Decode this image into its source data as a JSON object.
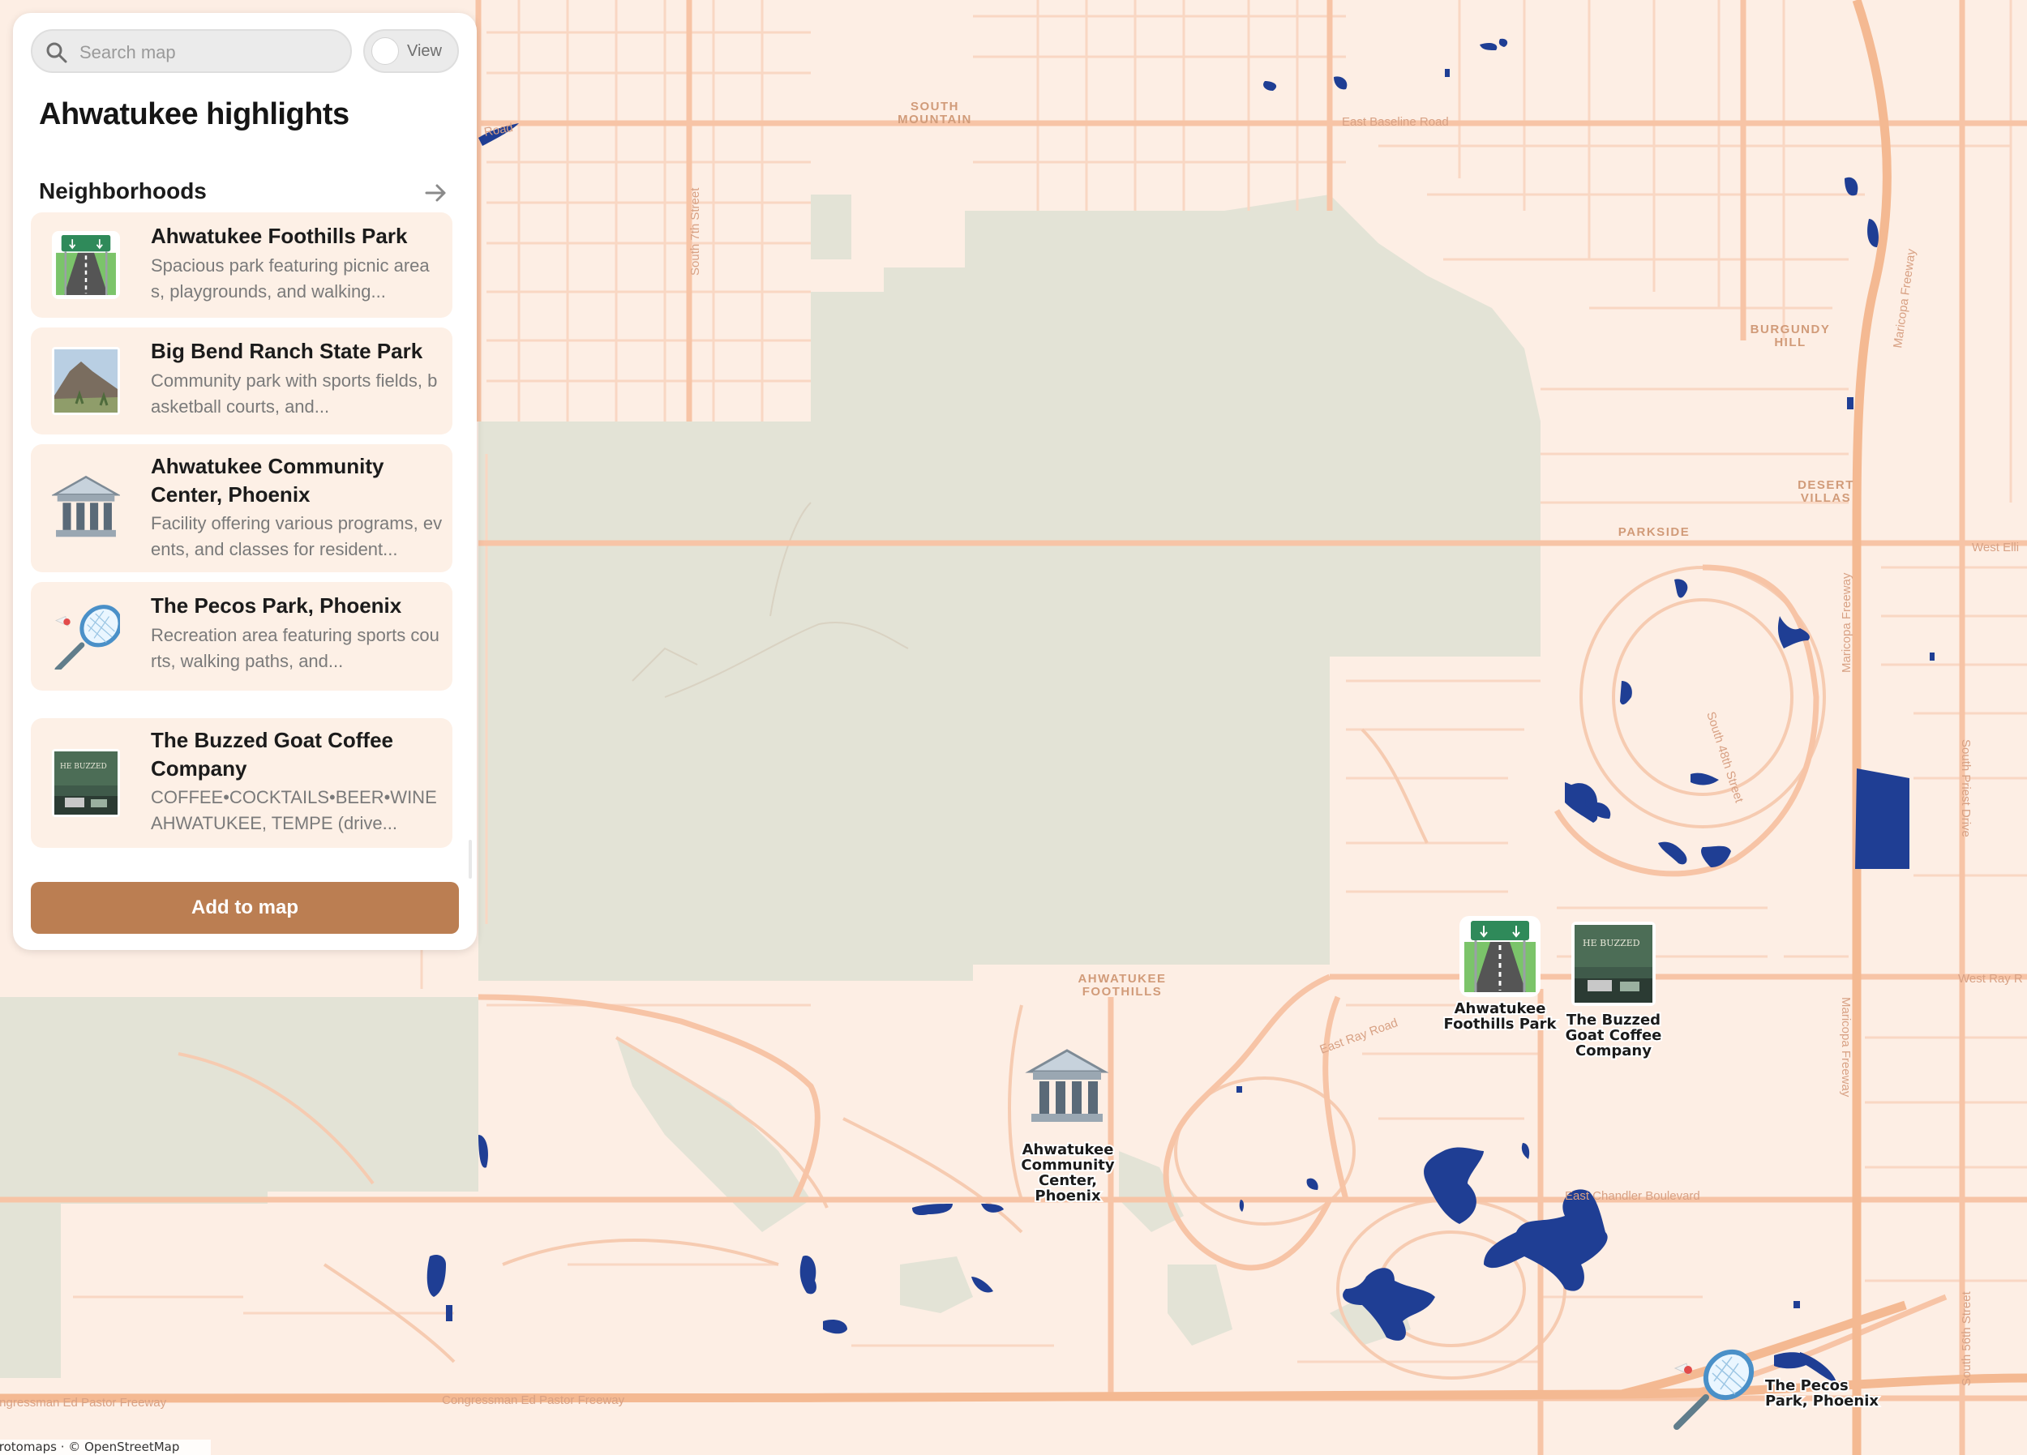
{
  "search": {
    "placeholder": "Search map"
  },
  "view_toggle": {
    "label": "View"
  },
  "panel": {
    "title": "Ahwatukee highlights",
    "section_title": "Neighborhoods",
    "add_button": "Add to map"
  },
  "places": [
    {
      "title": "Ahwatukee Foothills Park",
      "description": "Spacious park featuring picnic areas, playgrounds, and walking...",
      "icon": "highway-sign-road-icon"
    },
    {
      "title": "Big Bend Ranch State Park",
      "description": "Community park with sports fields, basketball courts, and...",
      "icon": "mountain-photo"
    },
    {
      "title": "Ahwatukee Community Center, Phoenix",
      "description": "Facility offering various programs, events, and classes for resident...",
      "icon": "classical-building-icon"
    },
    {
      "title": "The Pecos Park, Phoenix",
      "description": "Recreation area featuring sports courts, walking paths, and...",
      "icon": "badminton-racket-icon"
    },
    {
      "title": "The Buzzed Goat Coffee Company",
      "description": "COFFEE•COCKTAILS•BEER•WINE AHWATUKEE, TEMPE (drive...",
      "icon": "cafe-photo"
    }
  ],
  "map": {
    "attribution": "Protomaps · © OpenStreetMap",
    "area_labels": [
      "SOUTH",
      "MOUNTAIN",
      "BURGUNDY",
      "HILL",
      "DESERT",
      "VILLAS",
      "PARKSIDE",
      "AHWATUKEE",
      "FOOTHILLS"
    ],
    "street_labels": [
      "East Baseline Road",
      "South 7th Street",
      "Maricopa Freeway",
      "West Elli",
      "South 48th Street",
      "South Priest Drive",
      "West Ray R",
      "East Ray Road",
      "East Chandler Boulevard",
      "Congressman Ed Pastor Freeway",
      "South 56th Street",
      "Road",
      "ob",
      "d"
    ],
    "markers": {
      "foothills_park": "Ahwatukee Foothills Park",
      "buzzed_goat": "The Buzzed Goat Coffee Company",
      "community_center": "Ahwatukee Community Center, Phoenix",
      "pecos_park": "The Pecos Park, Phoenix"
    }
  },
  "colors": {
    "background": "#fdeee4",
    "mountain_preserve": "#e3e3d6",
    "roads": "#f7c9ad",
    "water": "#1f3e94",
    "button": "#bb7e52"
  }
}
